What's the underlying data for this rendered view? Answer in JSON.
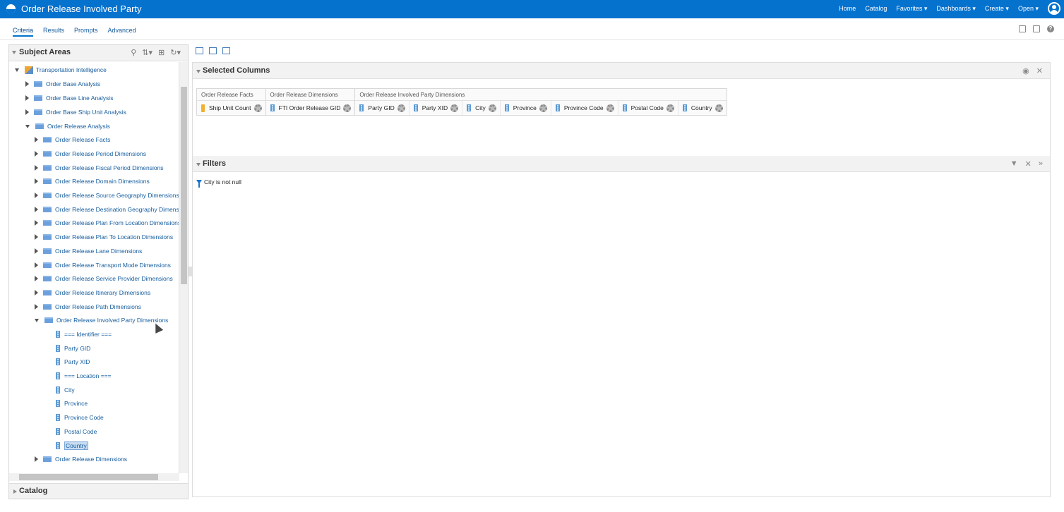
{
  "header": {
    "title": "Order Release Involved Party",
    "nav": [
      "Home",
      "Catalog",
      "Favorites ▾",
      "Dashboards ▾",
      "Create ▾",
      "Open ▾"
    ]
  },
  "tabs": [
    "Criteria",
    "Results",
    "Prompts",
    "Advanced"
  ],
  "subject_areas": {
    "title": "Subject Areas",
    "root": "Transportation Intelligence",
    "items": [
      "Order Base Analysis",
      "Order Base Line Analysis",
      "Order Base Ship Unit Analysis",
      "Order Release Analysis",
      "Order Release Facts",
      "Order Release Period Dimensions",
      "Order Release Fiscal Period Dimensions",
      "Order Release Domain Dimensions",
      "Order Release Source Geography Dimensions",
      "Order Release Destination Geography Dimens",
      "Order Release Plan From Location Dimensions",
      "Order Release Plan To Location Dimensions",
      "Order Release Lane Dimensions",
      "Order Release Transport Mode Dimensions",
      "Order Release Service Provider Dimensions",
      "Order Release Itinerary Dimensions",
      "Order Release Path Dimensions",
      "Order Release Involved Party Dimensions",
      "=== Identifier ===",
      "Party GID",
      "Party XID",
      "=== Location ===",
      "City",
      "Province",
      "Province Code",
      "Postal Code",
      "Country",
      "Order Release Dimensions"
    ]
  },
  "catalog": {
    "title": "Catalog"
  },
  "selected_columns": {
    "title": "Selected Columns",
    "groups": [
      {
        "label": "Order Release Facts",
        "columns": [
          "Ship Unit Count"
        ]
      },
      {
        "label": "Order Release Dimensions",
        "columns": [
          "FTI Order Release GID"
        ]
      },
      {
        "label": "Order Release Involved Party Dimensions",
        "columns": [
          "Party GID",
          "Party XID",
          "City",
          "Province",
          "Province Code",
          "Postal Code",
          "Country"
        ]
      }
    ]
  },
  "filters": {
    "title": "Filters",
    "items": [
      "City is not null"
    ]
  }
}
